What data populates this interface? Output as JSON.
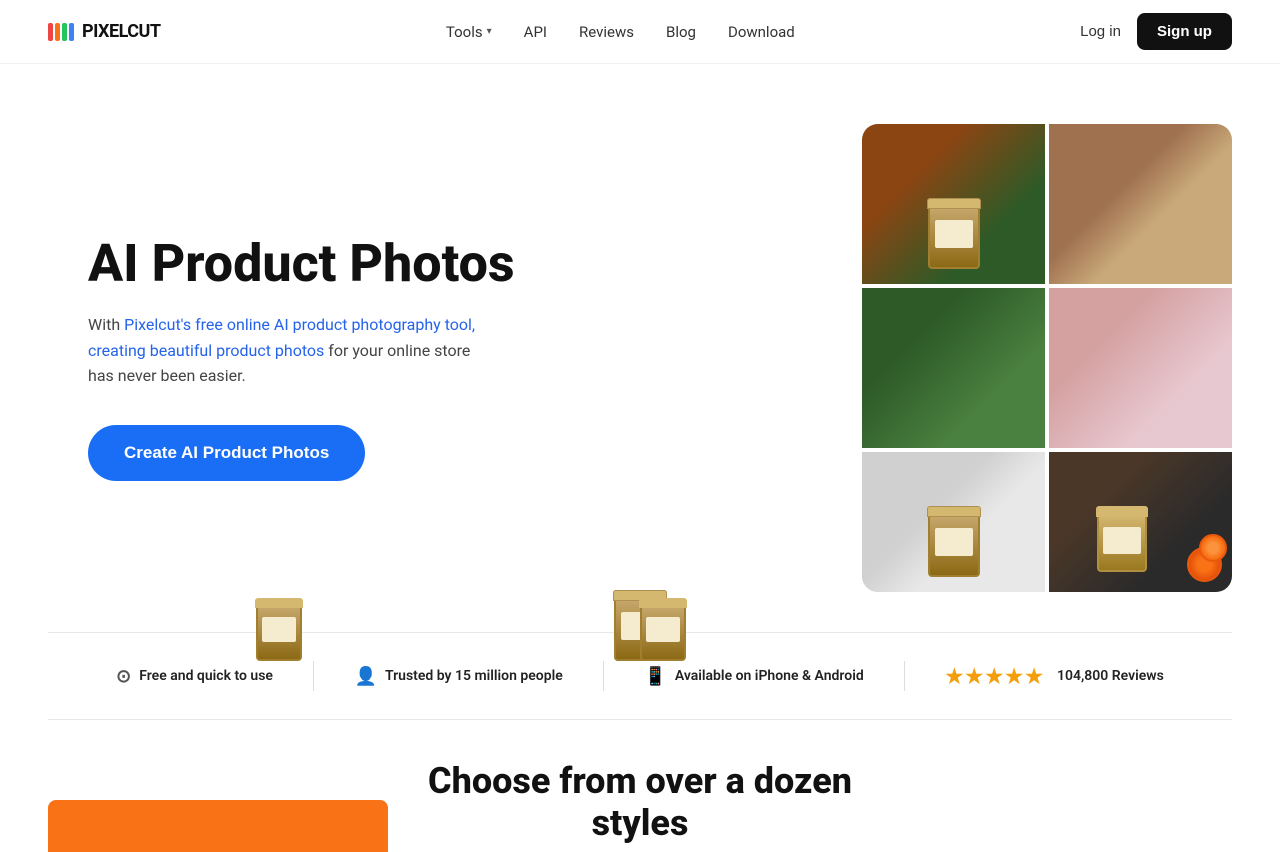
{
  "brand": {
    "name": "PIXELCUT",
    "logo_bars": [
      {
        "color": "#ef4444"
      },
      {
        "color": "#f97316"
      },
      {
        "color": "#22c55e"
      },
      {
        "color": "#3b82f6"
      }
    ]
  },
  "nav": {
    "tools_label": "Tools",
    "api_label": "API",
    "reviews_label": "Reviews",
    "blog_label": "Blog",
    "download_label": "Download",
    "login_label": "Log in",
    "signup_label": "Sign up"
  },
  "hero": {
    "title": "AI Product Photos",
    "description_prefix": "With ",
    "description_highlight": "Pixelcut's free online AI product photography tool, creating beautiful product photos",
    "description_suffix": " for your online store has never been easier.",
    "cta_label": "Create AI Product Photos"
  },
  "trust": {
    "items": [
      {
        "icon": "⊙",
        "text": "Free and quick to use"
      },
      {
        "icon": "👤",
        "text": "Trusted by 15 million people"
      },
      {
        "icon": "📱",
        "text": "Available on iPhone & Android"
      },
      {
        "stars": "★★★★★",
        "reviews": "104,800 Reviews"
      }
    ]
  },
  "bottom": {
    "section_title": "Choose from over a dozen styles"
  }
}
